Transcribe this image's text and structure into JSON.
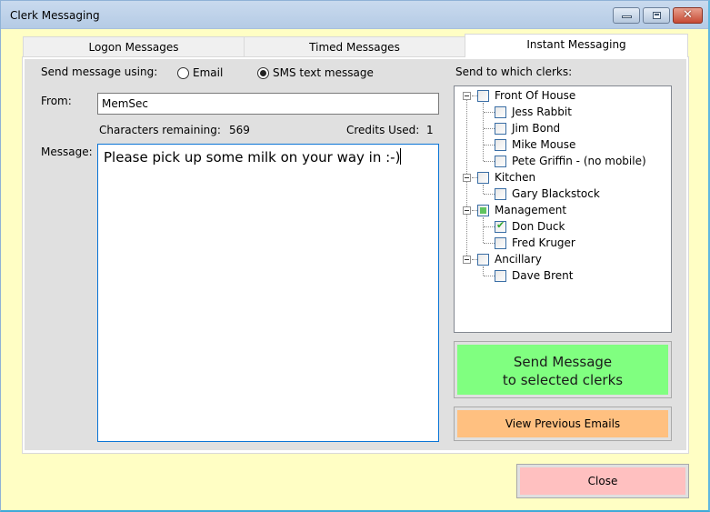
{
  "window": {
    "title": "Clerk Messaging",
    "controls": {
      "minimize": "minimize",
      "maximize": "maximize",
      "close": "✕"
    }
  },
  "tabs": [
    {
      "label": "Logon Messages",
      "active": false
    },
    {
      "label": "Timed Messages",
      "active": false
    },
    {
      "label": "Instant Messaging",
      "active": true
    }
  ],
  "form": {
    "send_using_label": "Send message using:",
    "options": [
      {
        "label": "Email",
        "selected": false
      },
      {
        "label": "SMS text message",
        "selected": true
      }
    ],
    "from_label": "From:",
    "from_value": "MemSec",
    "chars_remaining_label": "Characters remaining:",
    "chars_remaining_value": "569",
    "credits_used_label": "Credits Used:",
    "credits_used_value": "1",
    "message_label": "Message:",
    "message_value": "Please pick up some milk on your way in :-)"
  },
  "recipients": {
    "label": "Send to which clerks:",
    "groups": [
      {
        "name": "Front Of House",
        "state": "unchecked",
        "expanded": true,
        "members": [
          {
            "name": "Jess Rabbit",
            "checked": false
          },
          {
            "name": "Jim Bond",
            "checked": false
          },
          {
            "name": "Mike Mouse",
            "checked": false
          },
          {
            "name": "Pete Griffin - (no mobile)",
            "checked": false
          }
        ]
      },
      {
        "name": "Kitchen",
        "state": "unchecked",
        "expanded": true,
        "members": [
          {
            "name": "Gary Blackstock",
            "checked": false
          }
        ]
      },
      {
        "name": "Management",
        "state": "partial",
        "expanded": true,
        "members": [
          {
            "name": "Don Duck",
            "checked": true
          },
          {
            "name": "Fred Kruger",
            "checked": false
          }
        ]
      },
      {
        "name": "Ancillary",
        "state": "unchecked",
        "expanded": true,
        "members": [
          {
            "name": "Dave Brent",
            "checked": false
          }
        ]
      }
    ]
  },
  "buttons": {
    "send_line1": "Send Message",
    "send_line2": "to selected clerks",
    "view_previous": "View Previous Emails",
    "close": "Close"
  },
  "colors": {
    "window_bg": "#fffec4",
    "panel_bg": "#e0e0e0",
    "send_button": "#80ff80",
    "view_previous_button": "#ffc080",
    "close_button": "#ffc0c0",
    "checked_green": "#2fa52f"
  }
}
